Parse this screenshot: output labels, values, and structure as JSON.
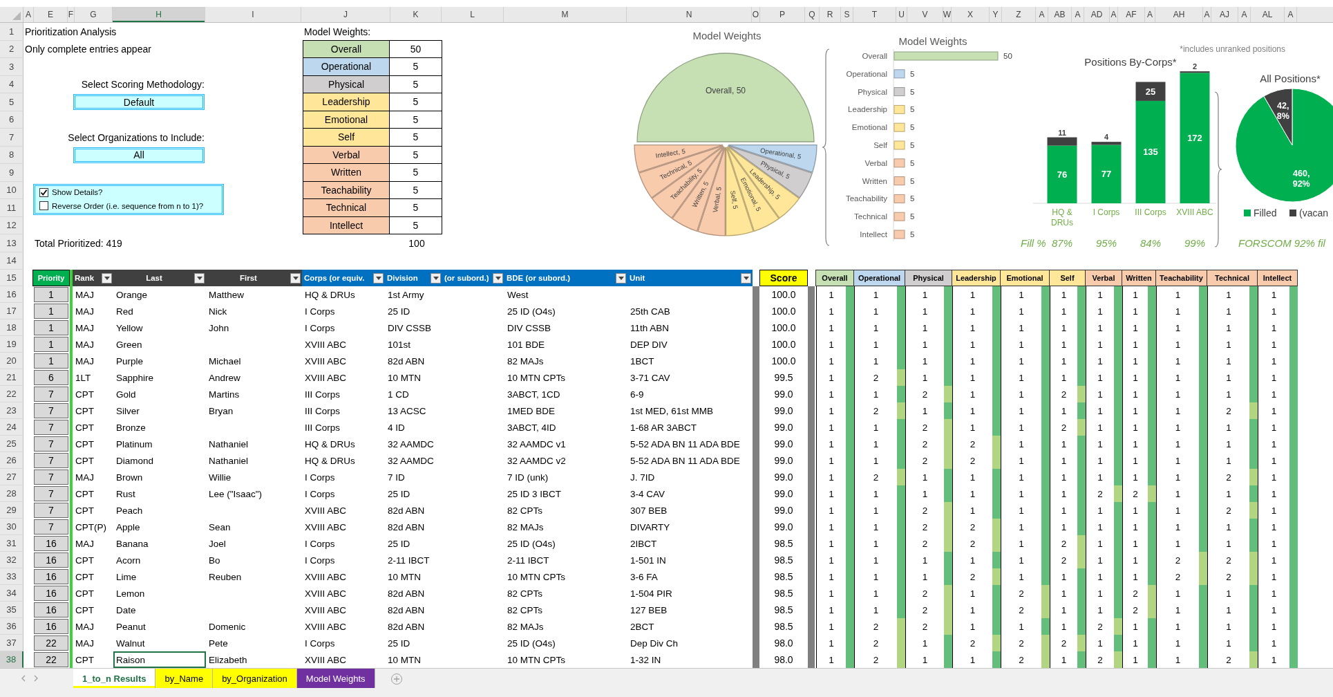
{
  "column_headers": [
    {
      "label": "A",
      "selected": false
    },
    {
      "label": "E",
      "selected": false
    },
    {
      "label": "F",
      "selected": false
    },
    {
      "label": "G",
      "selected": false
    },
    {
      "label": "H",
      "selected": true
    },
    {
      "label": "I",
      "selected": false
    },
    {
      "label": "J",
      "selected": false
    },
    {
      "label": "K",
      "selected": false
    },
    {
      "label": "L",
      "selected": false
    },
    {
      "label": "M",
      "selected": false
    },
    {
      "label": "N",
      "selected": false
    },
    {
      "label": "O",
      "selected": false
    },
    {
      "label": "P",
      "selected": false
    },
    {
      "label": "Q",
      "selected": false
    },
    {
      "label": "R",
      "selected": false
    },
    {
      "label": "S",
      "selected": false
    },
    {
      "label": "T",
      "selected": false
    },
    {
      "label": "U",
      "selected": false
    },
    {
      "label": "V",
      "selected": false
    },
    {
      "label": "W",
      "selected": false
    },
    {
      "label": "X",
      "selected": false
    },
    {
      "label": "Y",
      "selected": false
    },
    {
      "label": "Z",
      "selected": false
    },
    {
      "label": "A",
      "selected": false
    },
    {
      "label": "AB",
      "selected": false
    },
    {
      "label": "A",
      "selected": false
    },
    {
      "label": "AD",
      "selected": false
    },
    {
      "label": "A",
      "selected": false
    },
    {
      "label": "AF",
      "selected": false
    },
    {
      "label": "A",
      "selected": false
    },
    {
      "label": "AH",
      "selected": false
    },
    {
      "label": "A",
      "selected": false
    },
    {
      "label": "AJ",
      "selected": false
    },
    {
      "label": "A",
      "selected": false
    },
    {
      "label": "AL",
      "selected": false
    },
    {
      "label": "A",
      "selected": false
    }
  ],
  "row_numbers": [
    "1",
    "2",
    "3",
    "4",
    "5",
    "6",
    "7",
    "8",
    "9",
    "10",
    "11",
    "12",
    "13",
    "14",
    "15"
  ],
  "sheet": {
    "title": "Prioritization Analysis",
    "subtitle": "Only complete entries appear",
    "total": "Total Prioritized: 419"
  },
  "selectors": [
    {
      "label": "Select Scoring Methodology:",
      "value": "Default"
    },
    {
      "label": "Select Organizations to Include:",
      "value": "All"
    }
  ],
  "options": [
    {
      "label": "Show Details?",
      "checked": true
    },
    {
      "label": "Reverse Order (i.e. sequence from n to 1)?",
      "checked": false
    }
  ],
  "model_weights": {
    "title": "Model Weights:",
    "total": "100",
    "items": [
      {
        "name": "Overall",
        "value": "50",
        "color": "#c6e0b4"
      },
      {
        "name": "Operational",
        "value": "5",
        "color": "#bdd7ee"
      },
      {
        "name": "Physical",
        "value": "5",
        "color": "#d0cece"
      },
      {
        "name": "Leadership",
        "value": "5",
        "color": "#ffe699"
      },
      {
        "name": "Emotional",
        "value": "5",
        "color": "#ffe699"
      },
      {
        "name": "Self",
        "value": "5",
        "color": "#ffe699"
      },
      {
        "name": "Verbal",
        "value": "5",
        "color": "#f8cbad"
      },
      {
        "name": "Written",
        "value": "5",
        "color": "#f8cbad"
      },
      {
        "name": "Teachability",
        "value": "5",
        "color": "#f8cbad"
      },
      {
        "name": "Technical",
        "value": "5",
        "color": "#f8cbad"
      },
      {
        "name": "Intellect",
        "value": "5",
        "color": "#f8cbad"
      }
    ]
  },
  "weights_pie": {
    "chart_data": {
      "type": "pie",
      "title": "Model Weights",
      "values": [
        50,
        5,
        5,
        5,
        5,
        5,
        5,
        5,
        5,
        5,
        5
      ],
      "value_labels": [
        "Overall, 50",
        "Operational, 5",
        "Physical, 5",
        "Leadership, 5",
        "Emotional, 5",
        "Self, 5",
        "Verbal, 5",
        "Written, 5",
        "Teachability, 5",
        "Technical, 5",
        "Intellect, 5"
      ]
    }
  },
  "weights_bar": {
    "chart_data": {
      "type": "bar",
      "orientation": "horizontal",
      "title": "Model Weights",
      "categories": [
        "Overall",
        "Operational",
        "Physical",
        "Leadership",
        "Emotional",
        "Self",
        "Verbal",
        "Written",
        "Teachability",
        "Technical",
        "Intellect"
      ],
      "values": [
        50,
        5,
        5,
        5,
        5,
        5,
        5,
        5,
        5,
        5,
        5
      ],
      "value_labels": [
        "50",
        "5",
        "5",
        "5",
        "5",
        "5",
        "5",
        "5",
        "5",
        "5",
        "5"
      ]
    }
  },
  "corps_chart": {
    "note": "*includes unranked positions",
    "fill_label": "Fill %",
    "fill_values": [
      "87%",
      "95%",
      "84%",
      "99%"
    ],
    "chart_data": {
      "type": "bar",
      "title": "Positions By-Corps*",
      "stacked": true,
      "data_labels": true,
      "categories": [
        "HQ & DRUs",
        "I Corps",
        "III Corps",
        "XVIII ABC"
      ],
      "series": [
        {
          "color": "#00b050",
          "values": [
            76,
            77,
            135,
            172
          ]
        },
        {
          "color": "#404040",
          "values": [
            11,
            4,
            25,
            2
          ]
        }
      ]
    }
  },
  "all_positions": {
    "footer": "FORSCOM 92% fil",
    "chart_data": {
      "type": "pie",
      "title": "All Positions*",
      "legend": "bottom",
      "categories": [
        "Filled",
        "(vacan"
      ],
      "values": [
        460,
        42
      ],
      "value_labels": [
        "460, 92%",
        "42, 8%"
      ]
    }
  },
  "table": {
    "priority_header": "Priority",
    "score_header": "Score",
    "columns": [
      {
        "label": "Rank",
        "color": "#404040"
      },
      {
        "label": "Last",
        "color": "#404040"
      },
      {
        "label": "First",
        "color": "#404040"
      },
      {
        "label": "Corps (or equiv.",
        "color": "#0070c0"
      },
      {
        "label": "Division",
        "color": "#0070c0"
      },
      {
        "label": "(or subord.)",
        "color": "#0070c0"
      },
      {
        "label": "BDE (or subord.)",
        "color": "#0070c0"
      },
      {
        "label": "Unit",
        "color": "#0070c0"
      }
    ],
    "rating_columns": [
      {
        "label": "Overall",
        "color": "#c6e0b4"
      },
      {
        "label": "Operational",
        "color": "#bdd7ee"
      },
      {
        "label": "Physical",
        "color": "#d0cece"
      },
      {
        "label": "Leadership",
        "color": "#ffe699"
      },
      {
        "label": "Emotional",
        "color": "#ffe699"
      },
      {
        "label": "Self",
        "color": "#ffe699"
      },
      {
        "label": "Verbal",
        "color": "#f8cbad"
      },
      {
        "label": "Written",
        "color": "#f8cbad"
      },
      {
        "label": "Teachability",
        "color": "#f8cbad"
      },
      {
        "label": "Technical",
        "color": "#f8cbad"
      },
      {
        "label": "Intellect",
        "color": "#f8cbad"
      }
    ],
    "rows": [
      {
        "row": "16",
        "priority": "1",
        "rank": "MAJ",
        "last": "Orange",
        "first": "Matthew",
        "corps": "HQ & DRUs",
        "division": "1st Army",
        "bde": "West",
        "score": "100.0",
        "ratings": [
          "1",
          "1",
          "1",
          "1",
          "1",
          "1",
          "1",
          "1",
          "1",
          "1",
          "1"
        ],
        "selected": false
      },
      {
        "row": "17",
        "priority": "1",
        "rank": "MAJ",
        "last": "Red",
        "first": "Nick",
        "corps": "I Corps",
        "division": "25 ID",
        "bde": "25 ID (O4s)",
        "unit": "25th CAB",
        "score": "100.0",
        "ratings": [
          "1",
          "1",
          "1",
          "1",
          "1",
          "1",
          "1",
          "1",
          "1",
          "1",
          "1"
        ],
        "selected": false
      },
      {
        "row": "18",
        "priority": "1",
        "rank": "MAJ",
        "last": "Yellow",
        "first": "John",
        "corps": "I Corps",
        "division": "DIV CSSB",
        "bde": "DIV CSSB",
        "unit": "11th ABN",
        "score": "100.0",
        "ratings": [
          "1",
          "1",
          "1",
          "1",
          "1",
          "1",
          "1",
          "1",
          "1",
          "1",
          "1"
        ],
        "selected": false
      },
      {
        "row": "19",
        "priority": "1",
        "rank": "MAJ",
        "last": "Green",
        "corps": "XVIII ABC",
        "division": "101st",
        "bde": "101 BDE",
        "unit": "DEP DIV",
        "score": "100.0",
        "ratings": [
          "1",
          "1",
          "1",
          "1",
          "1",
          "1",
          "1",
          "1",
          "1",
          "1",
          "1"
        ],
        "selected": false
      },
      {
        "row": "20",
        "priority": "1",
        "rank": "MAJ",
        "last": "Purple",
        "first": "Michael",
        "corps": "XVIII ABC",
        "division": "82d ABN",
        "bde": "82 MAJs",
        "unit": "1BCT",
        "score": "100.0",
        "ratings": [
          "1",
          "1",
          "1",
          "1",
          "1",
          "1",
          "1",
          "1",
          "1",
          "1",
          "1"
        ],
        "selected": false
      },
      {
        "row": "21",
        "priority": "6",
        "rank": "1LT",
        "last": "Sapphire",
        "first": "Andrew",
        "corps": "XVIII ABC",
        "division": "10 MTN",
        "bde": "10 MTN CPTs",
        "unit": "3-71 CAV",
        "score": "99.5",
        "ratings": [
          "1",
          "2",
          "1",
          "1",
          "1",
          "1",
          "1",
          "1",
          "1",
          "1",
          "1"
        ],
        "selected": false
      },
      {
        "row": "22",
        "priority": "7",
        "rank": "CPT",
        "last": "Gold",
        "first": "Martins",
        "corps": "III Corps",
        "division": "1 CD",
        "bde": "3ABCT, 1CD",
        "unit": "6-9",
        "score": "99.0",
        "ratings": [
          "1",
          "1",
          "2",
          "1",
          "1",
          "2",
          "1",
          "1",
          "1",
          "1",
          "1"
        ],
        "selected": false
      },
      {
        "row": "23",
        "priority": "7",
        "rank": "CPT",
        "last": "Silver",
        "first": "Bryan",
        "corps": "III Corps",
        "division": "13 ACSC",
        "bde": "1MED BDE",
        "unit": "1st MED, 61st MMB",
        "score": "99.0",
        "ratings": [
          "1",
          "2",
          "1",
          "1",
          "1",
          "1",
          "1",
          "1",
          "1",
          "2",
          "1"
        ],
        "selected": false
      },
      {
        "row": "24",
        "priority": "7",
        "rank": "CPT",
        "last": "Bronze",
        "corps": "III Corps",
        "division": "4 ID",
        "bde": "3ABCT, 4ID",
        "unit": "1-68 AR 3ABCT",
        "score": "99.0",
        "ratings": [
          "1",
          "1",
          "2",
          "1",
          "1",
          "2",
          "1",
          "1",
          "1",
          "1",
          "1"
        ],
        "selected": false
      },
      {
        "row": "25",
        "priority": "7",
        "rank": "CPT",
        "last": "Platinum",
        "first": "Nathaniel",
        "corps": "HQ & DRUs",
        "division": "32 AAMDC",
        "bde": "32 AAMDC v1",
        "unit": "5-52 ADA BN 11 ADA BDE",
        "score": "99.0",
        "ratings": [
          "1",
          "1",
          "2",
          "2",
          "1",
          "1",
          "1",
          "1",
          "1",
          "1",
          "1"
        ],
        "selected": false
      },
      {
        "row": "26",
        "priority": "7",
        "rank": "CPT",
        "last": "Diamond",
        "first": "Nathaniel",
        "corps": "HQ & DRUs",
        "division": "32 AAMDC",
        "bde": "32 AAMDC v2",
        "unit": "5-52 ADA BN 11 ADA BDE",
        "score": "99.0",
        "ratings": [
          "1",
          "1",
          "2",
          "2",
          "1",
          "1",
          "1",
          "1",
          "1",
          "1",
          "1"
        ],
        "selected": false
      },
      {
        "row": "27",
        "priority": "7",
        "rank": "MAJ",
        "last": "Brown",
        "first": "Willie",
        "corps": "I Corps",
        "division": "7 ID",
        "bde": "7 ID (unk)",
        "unit": "J. 7ID",
        "score": "99.0",
        "ratings": [
          "1",
          "2",
          "1",
          "1",
          "1",
          "1",
          "1",
          "1",
          "1",
          "2",
          "1"
        ],
        "selected": false
      },
      {
        "row": "28",
        "priority": "7",
        "rank": "CPT",
        "last": "Rust",
        "first": "Lee (\"Isaac\")",
        "corps": "I Corps",
        "division": "25 ID",
        "bde": "25 ID 3 IBCT",
        "unit": "3-4 CAV",
        "score": "99.0",
        "ratings": [
          "1",
          "1",
          "1",
          "1",
          "1",
          "1",
          "2",
          "2",
          "1",
          "1",
          "1"
        ],
        "selected": false
      },
      {
        "row": "29",
        "priority": "7",
        "rank": "CPT",
        "last": "Peach",
        "corps": "XVIII ABC",
        "division": "82d ABN",
        "bde": "82 CPTs",
        "unit": "307 BEB",
        "score": "99.0",
        "ratings": [
          "1",
          "1",
          "2",
          "1",
          "1",
          "1",
          "1",
          "1",
          "1",
          "2",
          "1"
        ],
        "selected": false
      },
      {
        "row": "30",
        "priority": "7",
        "rank": "CPT(P)",
        "last": "Apple",
        "first": "Sean",
        "corps": "XVIII ABC",
        "division": "82d ABN",
        "bde": "82 MAJs",
        "unit": "DIVARTY",
        "score": "99.0",
        "ratings": [
          "1",
          "1",
          "2",
          "2",
          "1",
          "1",
          "1",
          "1",
          "1",
          "1",
          "1"
        ],
        "selected": false
      },
      {
        "row": "31",
        "priority": "16",
        "rank": "MAJ",
        "last": "Banana",
        "first": "Joel",
        "corps": "I Corps",
        "division": "25 ID",
        "bde": "25 ID (O4s)",
        "unit": "2IBCT",
        "score": "98.5",
        "ratings": [
          "1",
          "1",
          "2",
          "2",
          "1",
          "2",
          "1",
          "1",
          "1",
          "1",
          "1"
        ],
        "selected": false
      },
      {
        "row": "32",
        "priority": "16",
        "rank": "CPT",
        "last": "Acorn",
        "first": "Bo",
        "corps": "I Corps",
        "division": "2-11 IBCT",
        "bde": "2-11 IBCT",
        "unit": "1-501 IN",
        "score": "98.5",
        "ratings": [
          "1",
          "1",
          "1",
          "1",
          "1",
          "2",
          "1",
          "1",
          "2",
          "2",
          "1"
        ],
        "selected": false
      },
      {
        "row": "33",
        "priority": "16",
        "rank": "CPT",
        "last": "Lime",
        "first": "Reuben",
        "corps": "XVIII ABC",
        "division": "10 MTN",
        "bde": "10 MTN CPTs",
        "unit": "3-6 FA",
        "score": "98.5",
        "ratings": [
          "1",
          "1",
          "1",
          "2",
          "1",
          "1",
          "1",
          "1",
          "2",
          "2",
          "1"
        ],
        "selected": false
      },
      {
        "row": "34",
        "priority": "16",
        "rank": "CPT",
        "last": "Lemon",
        "corps": "XVIII ABC",
        "division": "82d ABN",
        "bde": "82 CPTs",
        "unit": "1-504 PIR",
        "score": "98.5",
        "ratings": [
          "1",
          "1",
          "2",
          "1",
          "2",
          "1",
          "1",
          "2",
          "1",
          "1",
          "1"
        ],
        "selected": false
      },
      {
        "row": "35",
        "priority": "16",
        "rank": "CPT",
        "last": "Date",
        "corps": "XVIII ABC",
        "division": "82d ABN",
        "bde": "82 CPTs",
        "unit": "127 BEB",
        "score": "98.5",
        "ratings": [
          "1",
          "1",
          "2",
          "1",
          "2",
          "1",
          "1",
          "2",
          "1",
          "1",
          "1"
        ],
        "selected": false
      },
      {
        "row": "36",
        "priority": "16",
        "rank": "MAJ",
        "last": "Peanut",
        "first": "Domenic",
        "corps": "XVIII ABC",
        "division": "82d ABN",
        "bde": "82 MAJs",
        "unit": "2BCT",
        "score": "98.5",
        "ratings": [
          "1",
          "2",
          "2",
          "1",
          "1",
          "1",
          "2",
          "1",
          "1",
          "1",
          "1"
        ],
        "selected": false
      },
      {
        "row": "37",
        "priority": "22",
        "rank": "MAJ",
        "last": "Walnut",
        "first": "Pete",
        "corps": "I Corps",
        "division": "25 ID",
        "bde": "25 ID (O4s)",
        "unit": "Dep Div Ch",
        "score": "98.0",
        "ratings": [
          "1",
          "2",
          "1",
          "2",
          "2",
          "2",
          "1",
          "1",
          "1",
          "1",
          "1"
        ],
        "selected": false
      },
      {
        "row": "38",
        "priority": "22",
        "rank": "CPT",
        "last": "Raison",
        "first": "Elizabeth",
        "corps": "XVIII ABC",
        "division": "10 MTN",
        "bde": "10 MTN CPTs",
        "unit": "1-32 IN",
        "score": "98.0",
        "ratings": [
          "1",
          "2",
          "1",
          "1",
          "2",
          "1",
          "2",
          "1",
          "1",
          "2",
          "1"
        ],
        "selected": true
      }
    ]
  },
  "tabs": [
    {
      "label": "1_to_n Results",
      "color": "#ffff00",
      "selected": true
    },
    {
      "label": "by_Name",
      "color": "#ffff00",
      "selected": false
    },
    {
      "label": "by_Organization",
      "color": "#ffff00",
      "selected": false
    },
    {
      "label": "Model Weights",
      "color": "#7030a0",
      "selected": false
    }
  ]
}
